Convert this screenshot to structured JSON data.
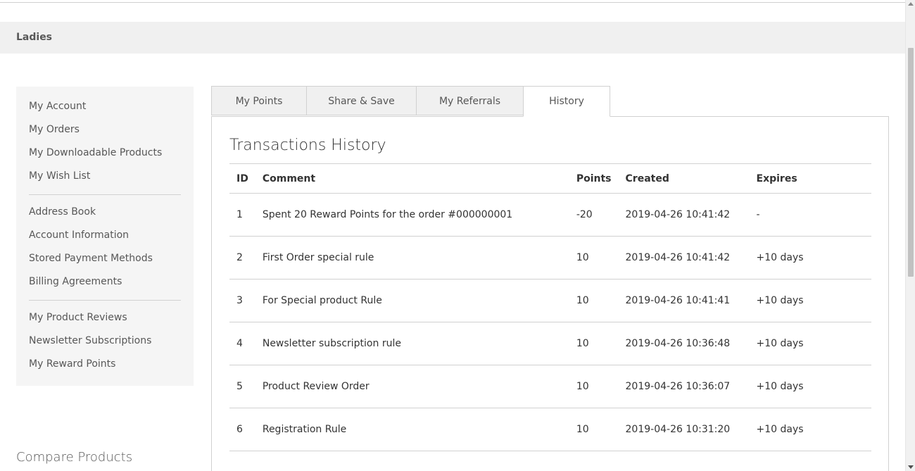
{
  "nav": {
    "category": "Ladies"
  },
  "sidebar": {
    "items": [
      {
        "label": "My Account"
      },
      {
        "label": "My Orders"
      },
      {
        "label": "My Downloadable Products"
      },
      {
        "label": "My Wish List"
      },
      {
        "label": "Address Book"
      },
      {
        "label": "Account Information"
      },
      {
        "label": "Stored Payment Methods"
      },
      {
        "label": "Billing Agreements"
      },
      {
        "label": "My Product Reviews"
      },
      {
        "label": "Newsletter Subscriptions"
      },
      {
        "label": "My Reward Points"
      }
    ]
  },
  "compare": {
    "title": "Compare Products"
  },
  "tabs": [
    {
      "label": "My Points",
      "active": false
    },
    {
      "label": "Share & Save",
      "active": false
    },
    {
      "label": "My Referrals",
      "active": false
    },
    {
      "label": "History",
      "active": true
    }
  ],
  "history": {
    "title": "Transactions History",
    "columns": {
      "id": "ID",
      "comment": "Comment",
      "points": "Points",
      "created": "Created",
      "expires": "Expires"
    },
    "rows": [
      {
        "id": "1",
        "comment": "Spent 20 Reward Points for the order #000000001",
        "points": "-20",
        "created": "2019-04-26 10:41:42",
        "expires": "-"
      },
      {
        "id": "2",
        "comment": "First Order special rule",
        "points": "10",
        "created": "2019-04-26 10:41:42",
        "expires": "+10 days"
      },
      {
        "id": "3",
        "comment": "For Special product Rule",
        "points": "10",
        "created": "2019-04-26 10:41:41",
        "expires": "+10 days"
      },
      {
        "id": "4",
        "comment": "Newsletter subscription rule",
        "points": "10",
        "created": "2019-04-26 10:36:48",
        "expires": "+10 days"
      },
      {
        "id": "5",
        "comment": "Product Review Order",
        "points": "10",
        "created": "2019-04-26 10:36:07",
        "expires": "+10 days"
      },
      {
        "id": "6",
        "comment": "Registration Rule",
        "points": "10",
        "created": "2019-04-26 10:31:20",
        "expires": "+10 days"
      }
    ]
  },
  "colors": {
    "negative_points": "#e02b27",
    "positive_points": "#1f7a1f",
    "sidebar_bg": "#f5f5f5",
    "nav_bg": "#f0f0f0"
  }
}
